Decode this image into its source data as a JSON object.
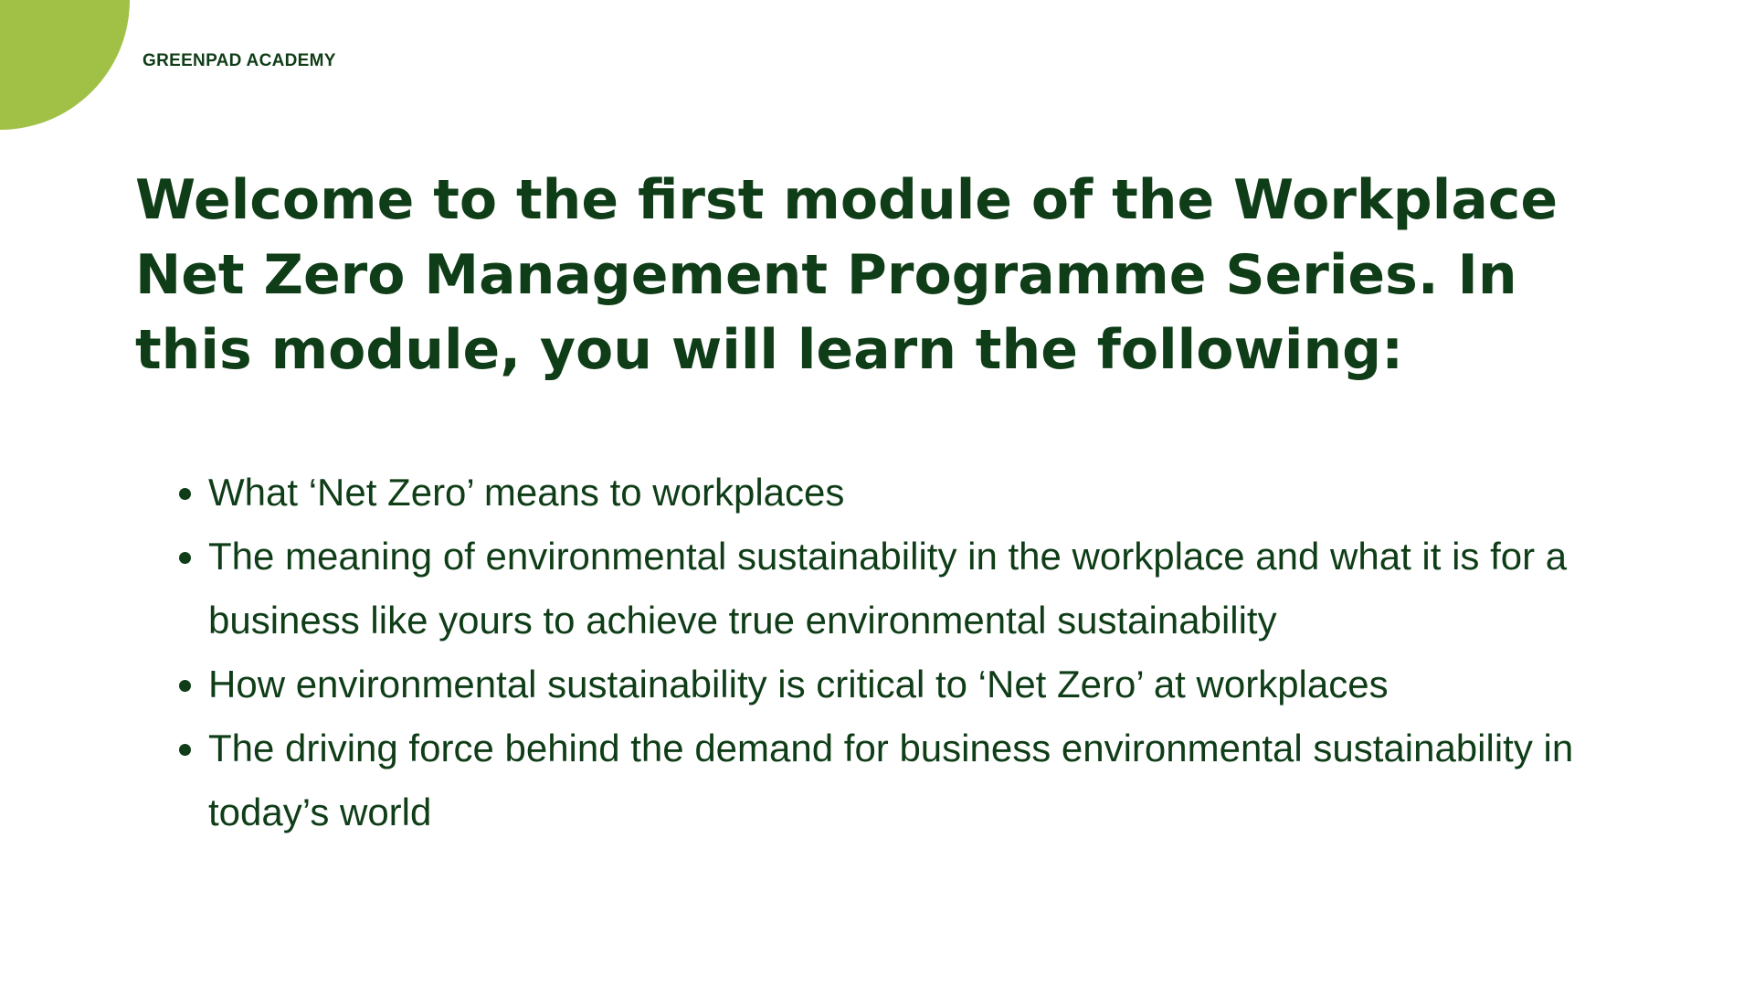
{
  "brand": {
    "name": "GREENPAD ACADEMY",
    "accent_color": "#a0c146",
    "text_color": "#0f3d17"
  },
  "slide": {
    "heading": "Welcome to the first module of the Workplace Net Zero Management Programme Series. In this module, you will learn the following:",
    "bullets": [
      "What ‘Net Zero’ means to workplaces",
      "The meaning of environmental sustainability in the workplace and what it is for a business like yours to achieve true environmental sustainability",
      "How environmental sustainability is critical to ‘Net Zero’ at workplaces",
      "The driving force behind the demand for business environmental sustainability in today’s world"
    ]
  }
}
